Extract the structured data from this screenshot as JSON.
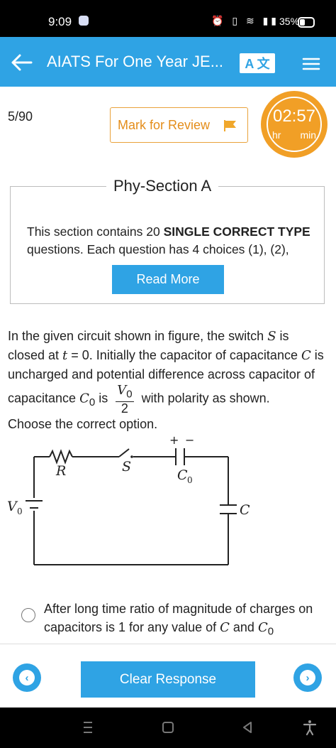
{
  "status_bar": {
    "time": "9:09",
    "battery": "35%"
  },
  "app_bar": {
    "title": "AIATS For One Year JE...",
    "translate_label": "A 文"
  },
  "question_counter": "5/90",
  "mark_for_review_label": "Mark for Review",
  "timer": {
    "time": "02:57",
    "unit_hr": "hr",
    "unit_min": "min"
  },
  "section": {
    "title": "Phy-Section A",
    "desc_prefix": "This section contains 20 ",
    "desc_bold": "SINGLE CORRECT TYPE",
    "desc_suffix": " questions. Each question has 4 choices (1), (2),",
    "read_more_label": "Read More"
  },
  "question": {
    "part1": "In the given circuit shown in figure, the switch ",
    "var_S": "S",
    "part2": " is closed at ",
    "var_t": "t",
    "part3": " = 0. Initially the capacitor of capacitance ",
    "var_C": "C",
    "part4": " is uncharged and potential difference across capacitor of capacitance ",
    "var_C0": "C",
    "sub0": "0",
    "part5": " is ",
    "frac_num": "V",
    "frac_num_sub": "0",
    "frac_den": "2",
    "part6": " with polarity as shown.",
    "line2": "Choose the correct option."
  },
  "circuit_labels": {
    "R": "R",
    "S": "S",
    "C0": "C",
    "C0_sub": "0",
    "C": "C",
    "V0": "V",
    "V0_sub": "0",
    "plus": "+",
    "minus": "−"
  },
  "option": {
    "text1": "After long time ratio of magnitude of charges on capacitors is 1 for any value of ",
    "var_C": "C",
    "and": " and ",
    "var_C0": "C",
    "sub0": "0"
  },
  "clear_response_label": "Clear Response",
  "nav": {
    "prev_icon": "‹",
    "next_icon": "›"
  },
  "colors": {
    "accent": "#2fa3e4",
    "timer": "#f19f26",
    "review": "#e48d1a"
  }
}
